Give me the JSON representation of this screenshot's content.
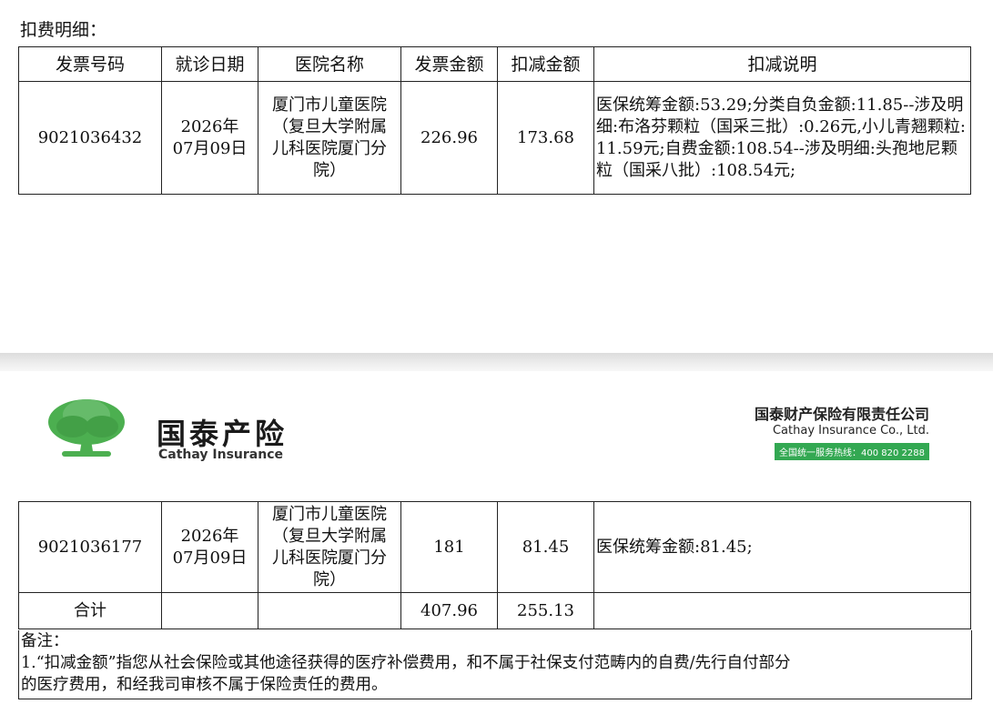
{
  "section_title": "扣费明细：",
  "table": {
    "headers": [
      "发票号码",
      "就诊日期",
      "医院名称",
      "发票金额",
      "扣减金额",
      "扣减说明"
    ],
    "rows": [
      {
        "invoice_no": "9021036432",
        "date_line1": "2026年",
        "date_line2": "07月09日",
        "hospital_lines": [
          "厦门市儿童医院",
          "（复旦大学附属",
          "儿科医院厦门分",
          "院）"
        ],
        "invoice_amount": "226.96",
        "deduction": "173.68",
        "explanation": "医保统筹金额:53.29;分类自负金额:11.85--涉及明细:布洛芬颗粒（国采三批）:0.26元,小儿青翘颗粒:11.59元;自费金额:108.54--涉及明细:头孢地尼颗粒（国采八批）:108.54元;"
      },
      {
        "invoice_no": "9021036177",
        "date_line1": "2026年",
        "date_line2": "07月09日",
        "hospital_lines": [
          "厦门市儿童医院",
          "（复旦大学附属",
          "儿科医院厦门分",
          "院）"
        ],
        "invoice_amount": "181",
        "deduction": "81.45",
        "explanation": "医保统筹金额:81.45;"
      }
    ],
    "total": {
      "label": "合计",
      "invoice_amount": "407.96",
      "deduction": "255.13"
    }
  },
  "brand": {
    "name_cn": "国泰产险",
    "name_en": "Cathay Insurance",
    "company_cn": "国泰财产保险有限责任公司",
    "company_en": "Cathay Insurance Co., Ltd.",
    "hotline": "全国统一服务热线：400 820 2288",
    "logo_icon": "green-tree-logo",
    "brand_color": "#33a852"
  },
  "notes": {
    "title": "备注：",
    "line1": "1.“扣减金额”指您从社会保险或其他途径获得的医疗补偿费用，和不属于社保支付范畴内的自费/先行自付部分",
    "line2": "的医疗费用，和经我司审核不属于保险责任的费用。"
  }
}
